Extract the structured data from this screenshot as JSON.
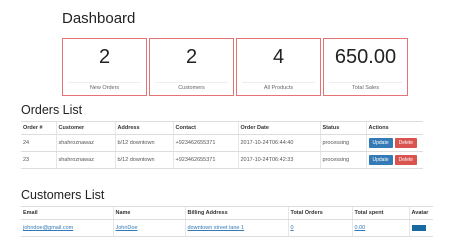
{
  "page": {
    "title": "Dashboard"
  },
  "stats": [
    {
      "value": "2",
      "label": "New Orders"
    },
    {
      "value": "2",
      "label": "Customers"
    },
    {
      "value": "4",
      "label": "All Products"
    },
    {
      "value": "650.00",
      "label": "Total Sales"
    }
  ],
  "orders": {
    "title": "Orders List",
    "columns": [
      "Order #",
      "Customer",
      "Address",
      "Contact",
      "Order Date",
      "Status",
      "Actions"
    ],
    "rows": [
      {
        "id": "24",
        "customer": "shahroznawaz",
        "address": "b/12 downtown",
        "contact": "+923462655371",
        "date": "2017-10-24T06:44:40",
        "status": "processing"
      },
      {
        "id": "23",
        "customer": "shahroznawaz",
        "address": "b/12 downtown",
        "contact": "+923462655371",
        "date": "2017-10-24T06:42:33",
        "status": "processing"
      }
    ],
    "update_label": "Update",
    "delete_label": "Delete"
  },
  "customers": {
    "title": "Customers List",
    "columns": [
      "Email",
      "Name",
      "Billing Address",
      "Total Orders",
      "Total spent",
      "Avatar"
    ],
    "rows": [
      {
        "email": "johndoe@gmail.com",
        "name": "JohnDoe",
        "address": "downtown street lane 1",
        "orders": "0",
        "spent": "0.00"
      }
    ]
  },
  "colors": {
    "card_border": "#e57373",
    "update": "#337ab7",
    "delete": "#d9534f",
    "link": "#337ab7"
  }
}
